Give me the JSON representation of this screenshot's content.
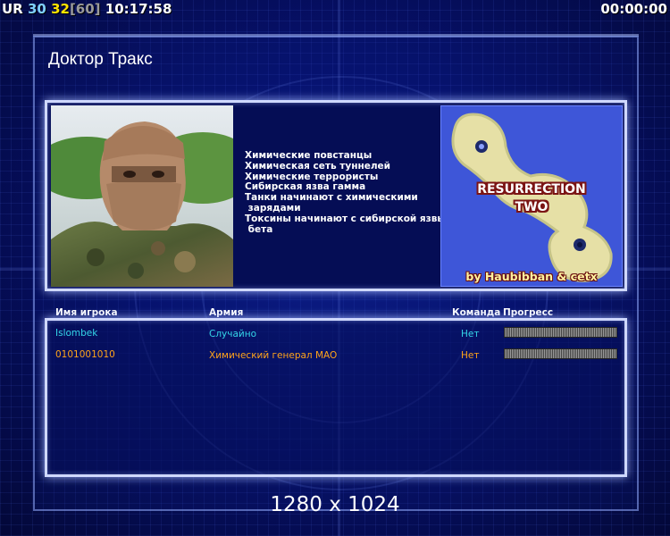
{
  "hud": {
    "ur_label": "UR",
    "fps": "30",
    "fps_current": "32",
    "fps_cap": "[60]",
    "clock": "10:17:58",
    "timer": "00:00:00"
  },
  "screen": {
    "title": "Доктор Тракс",
    "resolution": "1280 x 1024"
  },
  "rules": [
    "Химические повстанцы",
    "Химическая сеть туннелей",
    "Химические террористы",
    "Сибирская язва гамма",
    "Танки начинают с химическими",
    " зарядами",
    "Токсины начинают с сибирской язвы",
    " бета"
  ],
  "map": {
    "name_line1": "RESURRECTION",
    "name_line2": "TWO",
    "credit": "by Haubibban & cetx"
  },
  "table": {
    "headers": {
      "player": "Имя игрока",
      "army": "Армия",
      "team": "Команда",
      "progress": "Прогресс"
    },
    "rows": [
      {
        "player": "Islombek",
        "army": "Случайно",
        "team": "Нет",
        "color": "#34d6e8"
      },
      {
        "player": "0101001010",
        "army": "Химический генерал MAO",
        "team": "Нет",
        "color": "#ffa41a"
      }
    ]
  }
}
